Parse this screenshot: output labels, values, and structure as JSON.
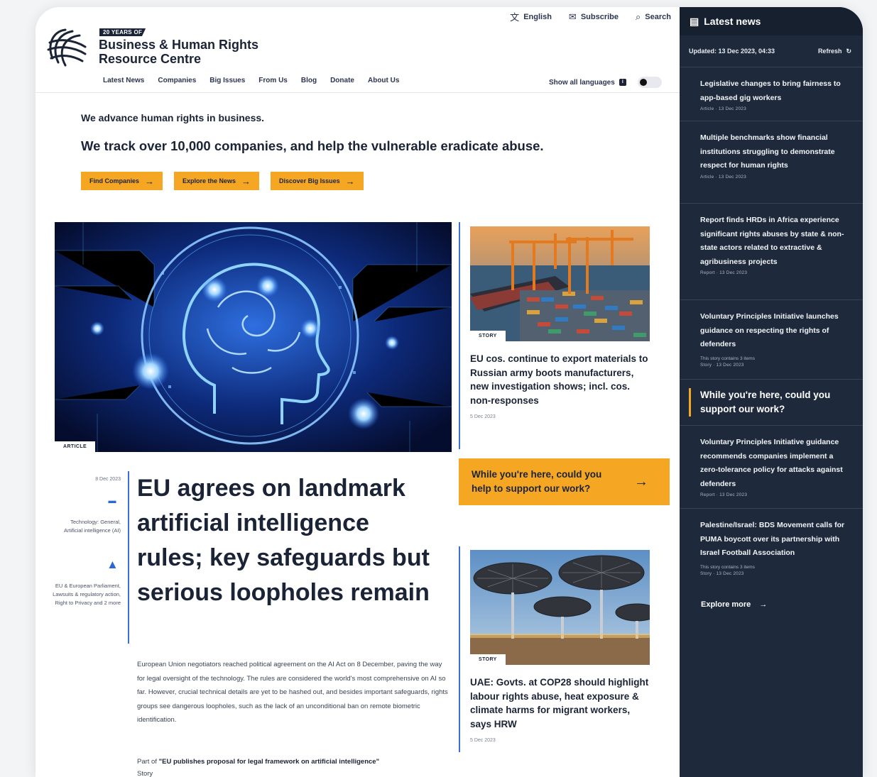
{
  "utility": {
    "english": "English",
    "subscribe": "Subscribe",
    "search": "Search"
  },
  "brand": {
    "badge": "20 YEARS OF",
    "name": "Business & Human Rights Resource Centre"
  },
  "nav": [
    "Latest News",
    "Companies",
    "Big Issues",
    "From Us",
    "Blog",
    "Donate",
    "About Us"
  ],
  "show_languages": "Show all languages",
  "hero": {
    "tagline1": "We advance human rights in business.",
    "tagline2": "We track over 10,000 companies, and help the vulnerable eradicate abuse.",
    "ctas": [
      "Find Companies",
      "Explore the News",
      "Discover Big Issues"
    ]
  },
  "feature": {
    "label": "ARTICLE",
    "date": "8 Dec 2023",
    "topics1": "Technology: General, Artificial intelligence (AI)",
    "topics2": "EU & European Parliament, Lawsuits & regulatory action, Right to Privacy and 2 more",
    "headline": "EU agrees on landmark artificial intelligence rules; key safeguards but serious loopholes remain",
    "summary": "European Union negotiators reached political agreement on the AI Act on 8 December, paving the way for legal oversight of the technology. The rules are considered the world's most comprehensive on AI so far. However, crucial technical details are yet to be hashed out, and besides important safeguards, rights groups see dangerous loopholes, such as the lack of an unconditional ban on remote biometric identification.",
    "part_of_prefix": "Part of",
    "part_of_title": "\"EU publishes proposal for legal framework on artificial intelligence\"",
    "part_of_type": "Story"
  },
  "stories": [
    {
      "label": "STORY",
      "title": "EU cos. continue to export materials to Russian army boots manufacturers, new investigation shows; incl. cos. non-responses",
      "date": "5 Dec 2023"
    },
    {
      "label": "STORY",
      "title": "UAE: Govts. at COP28 should highlight labour rights abuse, heat exposure & climate harms for migrant workers, says HRW",
      "date": "5 Dec 2023"
    }
  ],
  "support": {
    "text": "While you're here, could you help to support our work?"
  },
  "latest": {
    "title": "Latest news",
    "updated": "Updated: 13 Dec 2023, 04:33",
    "refresh": "Refresh",
    "items": [
      {
        "title": "Legislative changes to bring fairness to app-based gig workers",
        "meta": "Article · 13 Dec 2023"
      },
      {
        "title": "Multiple benchmarks show financial institutions struggling to demonstrate respect for human rights",
        "meta": "Article · 13 Dec 2023"
      },
      {
        "title": "Report finds HRDs in Africa experience significant rights abuses by state & non-state actors related to extractive & agribusiness projects",
        "meta": "Report · 13 Dec 2023"
      },
      {
        "title": "Voluntary Principles Initiative launches guidance on respecting the rights of defenders",
        "contains": "This story contains 3 items",
        "meta": "Story · 13 Dec 2023"
      }
    ],
    "support_text": "While you're here, could you support our work?",
    "items2": [
      {
        "title": "Voluntary Principles Initiative guidance recommends companies implement a zero-tolerance policy for attacks against defenders",
        "meta": "Report · 13 Dec 2023"
      },
      {
        "title": "Palestine/Israel: BDS Movement calls for PUMA boycott over its partnership with Israel Football Association",
        "contains": "This story contains 3 items",
        "meta": "Story · 13 Dec 2023"
      }
    ],
    "explore": "Explore more"
  }
}
